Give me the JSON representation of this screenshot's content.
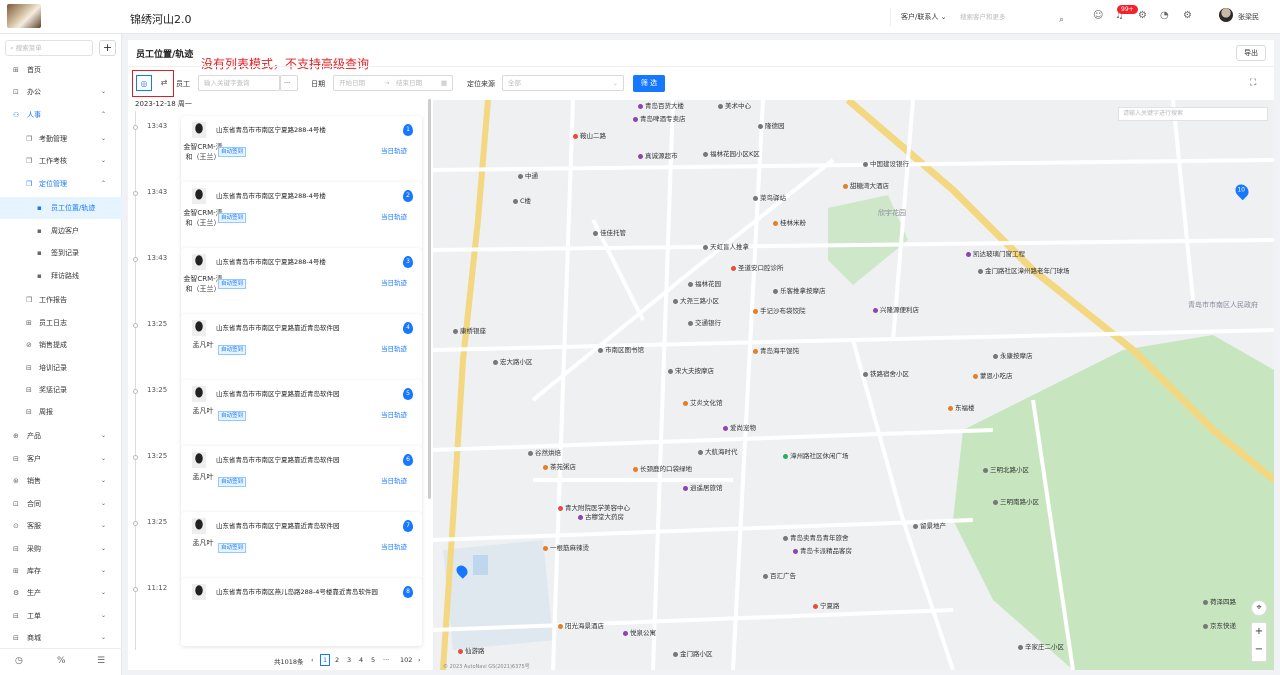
{
  "app": {
    "title": "锦绣河山2.0"
  },
  "header": {
    "select_value": "客户/联系人",
    "search_placeholder": "搜索客户和更多",
    "notification_count": "99+",
    "user_name": "张梁民"
  },
  "sidebar": {
    "search_placeholder": "搜索菜单",
    "items": [
      {
        "label": "首页"
      },
      {
        "label": "办公"
      },
      {
        "label": "人事"
      },
      {
        "label": "考勤管理"
      },
      {
        "label": "工作考核"
      },
      {
        "label": "定位管理"
      },
      {
        "label": "员工位置/轨迹"
      },
      {
        "label": "周边客户"
      },
      {
        "label": "签到记录"
      },
      {
        "label": "拜访路线"
      },
      {
        "label": "工作报告"
      },
      {
        "label": "员工日志"
      },
      {
        "label": "销售提成"
      },
      {
        "label": "培训记录"
      },
      {
        "label": "奖惩记录"
      },
      {
        "label": "周报"
      },
      {
        "label": "产品"
      },
      {
        "label": "客户"
      },
      {
        "label": "销售"
      },
      {
        "label": "合同"
      },
      {
        "label": "客服"
      },
      {
        "label": "采购"
      },
      {
        "label": "库存"
      },
      {
        "label": "生产"
      },
      {
        "label": "工单"
      },
      {
        "label": "商城"
      }
    ]
  },
  "page": {
    "title": "员工位置/轨迹",
    "export_label": "导出",
    "annotation": "没有列表模式，不支持高级查询",
    "filters": {
      "employee_label": "员工",
      "employee_placeholder": "输入关键字查询",
      "more": "···",
      "date_label": "日期",
      "date_start_placeholder": "开始日期",
      "date_end_placeholder": "结束日期",
      "source_label": "定位来源",
      "source_value": "全部",
      "filter_button": "筛 选"
    }
  },
  "track": {
    "date_header": "2023-12-18  周一",
    "records": [
      {
        "time": "13:43",
        "address": "山东省青岛市市南区宁夏路288-4号楼",
        "name": "金智CRM-清和（王兰）",
        "tag": "自动签到",
        "link": "当日轨迹",
        "num": "1"
      },
      {
        "time": "13:43",
        "address": "山东省青岛市市南区宁夏路288-4号楼",
        "name": "金智CRM-清和（王兰）",
        "tag": "自动签到",
        "link": "当日轨迹",
        "num": "2"
      },
      {
        "time": "13:43",
        "address": "山东省青岛市市南区宁夏路288-4号楼",
        "name": "金智CRM-清和（王兰）",
        "tag": "自动签到",
        "link": "当日轨迹",
        "num": "3"
      },
      {
        "time": "13:25",
        "address": "山东省青岛市市南区宁夏路靠近青岛软件园",
        "name": "孟凡叶",
        "tag": "自动签到",
        "link": "当日轨迹",
        "num": "4"
      },
      {
        "time": "13:25",
        "address": "山东省青岛市市南区宁夏路靠近青岛软件园",
        "name": "孟凡叶",
        "tag": "自动签到",
        "link": "当日轨迹",
        "num": "5"
      },
      {
        "time": "13:25",
        "address": "山东省青岛市市南区宁夏路靠近青岛软件园",
        "name": "孟凡叶",
        "tag": "自动签到",
        "link": "当日轨迹",
        "num": "6"
      },
      {
        "time": "13:25",
        "address": "山东省青岛市市南区宁夏路靠近青岛软件园",
        "name": "孟凡叶",
        "tag": "自动签到",
        "link": "当日轨迹",
        "num": "7"
      },
      {
        "time": "11:12",
        "address": "山东省青岛市市南区燕儿岛路288-4号楼靠近青岛软件园",
        "name": "",
        "tag": "",
        "link": "",
        "num": "8"
      }
    ]
  },
  "pagination": {
    "total": "共1018条",
    "prev": "‹",
    "pages": [
      "1",
      "2",
      "3",
      "4",
      "5"
    ],
    "ellipsis": "···",
    "last": "102",
    "next": "›"
  },
  "map": {
    "search_placeholder": "请输入关键字进行搜索",
    "copyright": "© 2023 AutoNavi  GS(2021)6375号",
    "pin_label": "10",
    "labels": [
      "青岛百货大楼",
      "美术中心",
      "隆德园",
      "青岛啤酒专卖店",
      "真诚源超市",
      "福林花园小区K区",
      "中国建设银行",
      "中通",
      "C楼",
      "甜糖湾大酒店",
      "菜鸟驿站",
      "佳佳托管",
      "桂林米粉",
      "欣宇花园",
      "天虹盲人推拿",
      "圣道安口腔诊所",
      "福林花园",
      "大尧三路小区",
      "乐客推拿按摩店",
      "手记沙布袋饺院",
      "交通银行",
      "康桥银座",
      "凯达玻璃门窗工程",
      "金门路社区漳州路老年门球场",
      "青岛市市南区人民政府",
      "兴隆源便利店",
      "青岛海平馄饨",
      "市南区图书馆",
      "宏大路小区",
      "宋大夫按摩店",
      "永康按摩店",
      "铁路宿舍小区",
      "蒙恩小吃店",
      "东福楼",
      "艾炎文化馆",
      "爱尚宠物",
      "谷然烘焙",
      "茶苑粥店",
      "大航海时代",
      "长颈鹿的口袋绿地",
      "漳州路社区休闲广场",
      "逍遥居旅馆",
      "三明北路小区",
      "青大附院医学美容中心",
      "古穆堂大药房",
      "三明南路小区",
      "青岛卖青岛青年旅舍",
      "留景地产",
      "青岛卡派精品客房",
      "一根筋麻辣烫",
      "百汇广告",
      "阳光海景酒店",
      "悦泉公寓",
      "金门路小区",
      "辛家庄二小区",
      "京东快递",
      "荷泽四路",
      "香港中路",
      "红岛路",
      "闽江路",
      "仙游路",
      "宁夏路",
      "鞍山二路"
    ]
  }
}
